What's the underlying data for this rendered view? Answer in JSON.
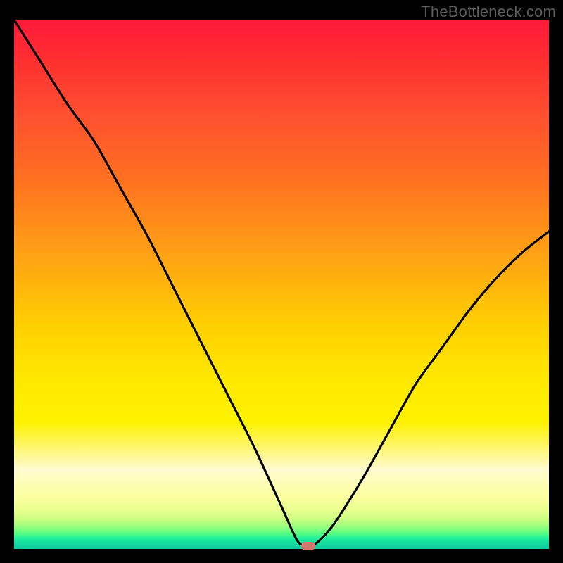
{
  "watermark": "TheBottleneck.com",
  "colors": {
    "page_bg": "#000000",
    "curve_stroke": "#000000",
    "minpoint_fill": "#d5766b",
    "gradient_top": "#ff1a3a",
    "gradient_bottom": "#10c9a0"
  },
  "chart_data": {
    "type": "line",
    "title": "",
    "xlabel": "",
    "ylabel": "",
    "xlim": [
      0,
      100
    ],
    "ylim": [
      0,
      100
    ],
    "grid": false,
    "legend": false,
    "annotations": [
      "TheBottleneck.com"
    ],
    "series": [
      {
        "name": "bottleneck-curve",
        "x": [
          0,
          5,
          10,
          15,
          20,
          25,
          30,
          35,
          40,
          45,
          50,
          53,
          55,
          57,
          60,
          65,
          70,
          75,
          80,
          85,
          90,
          95,
          100
        ],
        "values": [
          100,
          92,
          84,
          77,
          68,
          59,
          49,
          39,
          29,
          19,
          8,
          1.5,
          0.5,
          1.5,
          5,
          13,
          22,
          31,
          38,
          45,
          51,
          56,
          60
        ]
      }
    ],
    "min_point": {
      "x": 55,
      "y": 0.5
    }
  }
}
